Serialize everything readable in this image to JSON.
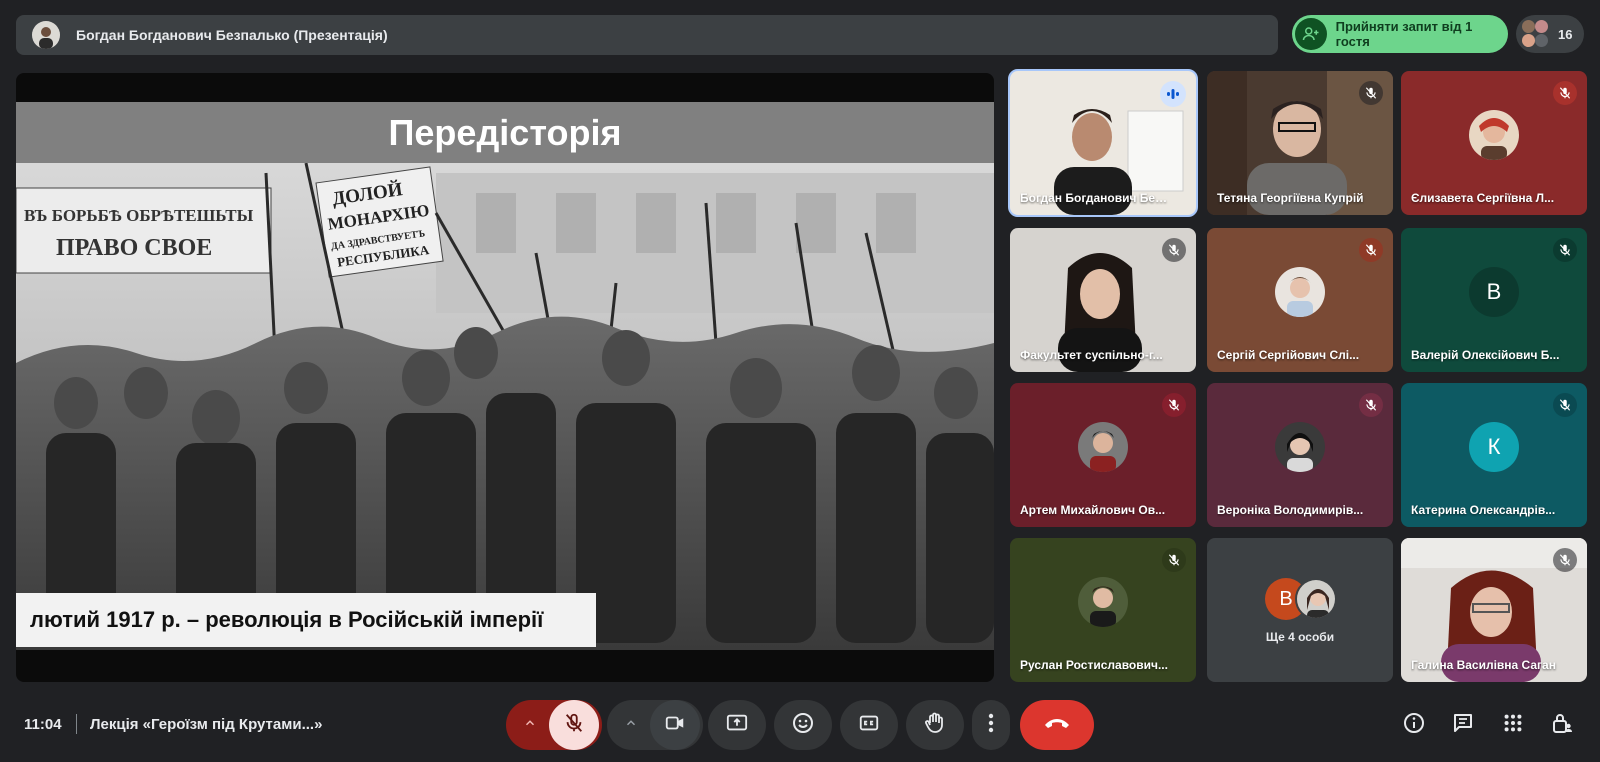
{
  "topbar": {
    "presenter_name": "Богдан Богданович Безпалько (Презентація)",
    "admit_label": "Прийняти запит від 1 гостя",
    "participant_count": "16"
  },
  "slide": {
    "title": "Передісторія",
    "caption": "лютий 1917 р. – революція в Російській імперії",
    "banner_left_line1": "ВЪ БОРЬБѢ ОБРѢТЕШЬТЫ",
    "banner_left_line2": "ПРАВО СВОЕ",
    "banner_right_line1": "ДОЛОЙ",
    "banner_right_line2": "МОНАРХІЮ",
    "banner_right_line3": "ДА ЗДРАВСТВУЕТЪ",
    "banner_right_line4": "РЕСПУБЛИКА"
  },
  "tiles": [
    {
      "name": "Богдан Богданович Без...",
      "status": "speaking"
    },
    {
      "name": "Тетяна Георгіївна Купрій",
      "status": "muted"
    },
    {
      "name": "Єлизавета Сергіївна Л...",
      "status": "muted"
    },
    {
      "name": "Факультет суспільно-г...",
      "status": "muted"
    },
    {
      "name": "Сергій Сергійович Слі...",
      "status": "muted"
    },
    {
      "name": "Валерій Олексійович Б...",
      "status": "muted",
      "letter": "В"
    },
    {
      "name": "Артем Михайлович Ов...",
      "status": "muted"
    },
    {
      "name": "Вероніка Володимирів...",
      "status": "muted"
    },
    {
      "name": "Катерина Олександрів...",
      "status": "muted",
      "letter": "К"
    },
    {
      "name": "Руслан Ростиславович...",
      "status": "muted"
    },
    {
      "name": "Ще 4 особи",
      "letter": "В"
    },
    {
      "name": "Галина Василівна Саган",
      "status": "muted"
    }
  ],
  "bottombar": {
    "time": "11:04",
    "meeting_title": "Лекція «Героїзм під Крутами...»"
  },
  "colors": {
    "background": "#202124",
    "admit_green": "#6dd58c",
    "end_call_red": "#dc362e",
    "mic_off_bg": "#f9dedc"
  }
}
